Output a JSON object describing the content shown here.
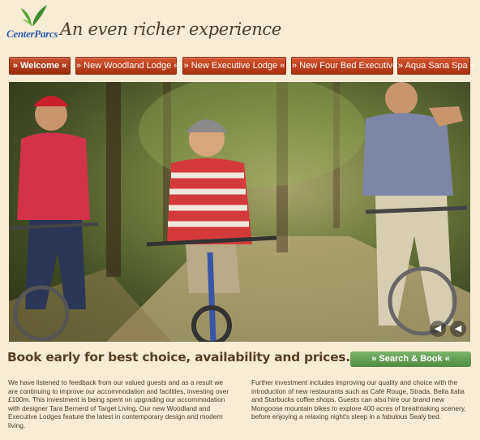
{
  "brand": {
    "logo_text": "CenterParcs",
    "tagline": "An even richer experience"
  },
  "nav": {
    "items": [
      {
        "label": "» Welcome «",
        "active": true
      },
      {
        "label": "» New Woodland Lodge «",
        "active": false
      },
      {
        "label": "» New Executive Lodge «",
        "active": false
      },
      {
        "label": "» New Four Bed Executive «",
        "active": false
      },
      {
        "label": "» Aqua Sana Spa «",
        "active": false
      }
    ]
  },
  "hero": {
    "prev_icon": "play-left-icon",
    "next_icon": "chevron-left-icon"
  },
  "promo": {
    "headline": "Book early for best choice, availability and prices.",
    "search_button": "» Search & Book «"
  },
  "body": {
    "left": "We have listened to feedback from our valued guests and as a result we are continuing to improve our accommodation and facilities, investing over £100m. This investment is being spent on upgrading our accommodation with designer Tara Bernerd of Target Living. Our new Woodland and Executive Lodges feature the latest in contemporary design and modern living.",
    "right": "Further investment includes improving our quality and choice with the introduction of new restaurants such as Café Rouge, Strada, Bella Italia and Starbucks coffee shops. Guests can also hire our brand new Mongoose mountain bikes to explore 400 acres of breathtaking scenery, before enjoying a relaxing night's sleep in a fabulous Sealy bed."
  },
  "colors": {
    "background": "#f7ecd6",
    "nav_red": "#b8391a",
    "cta_green": "#5e9c4e",
    "logo_blue": "#2b5ba8"
  }
}
